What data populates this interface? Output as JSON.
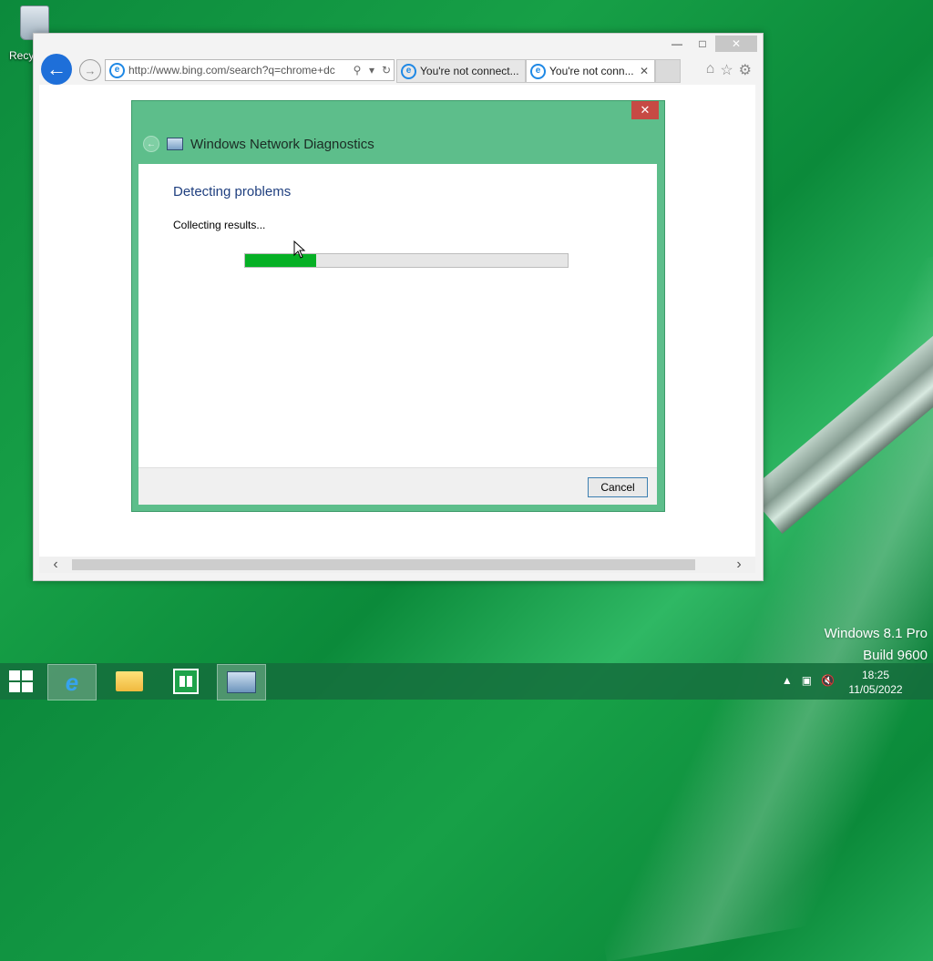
{
  "desktop": {
    "recycle_bin_label": "Recyc",
    "watermark_line1": "Windows 8.1 Pro",
    "watermark_line2": "Build 9600"
  },
  "browser": {
    "address": "http://www.bing.com/search?q=chrome+dc",
    "tabs": [
      {
        "title": "You're not connect..."
      },
      {
        "title": "You're not conn..."
      }
    ],
    "icons": [
      "home-icon",
      "star-icon",
      "gear-icon"
    ]
  },
  "dialog": {
    "title": "Windows Network Diagnostics",
    "heading": "Detecting problems",
    "status": "Collecting results...",
    "progress": 0.22,
    "cancel_label": "Cancel"
  },
  "taskbar": {
    "pinned": [
      "internet-explorer",
      "file-explorer",
      "store",
      "network-diagnostics"
    ],
    "time": "18:25",
    "date": "11/05/2022"
  },
  "colors": {
    "dialog_frame": "#5dbe8b",
    "progress_fill": "#06b025",
    "ie_back": "#1e6fd9"
  }
}
